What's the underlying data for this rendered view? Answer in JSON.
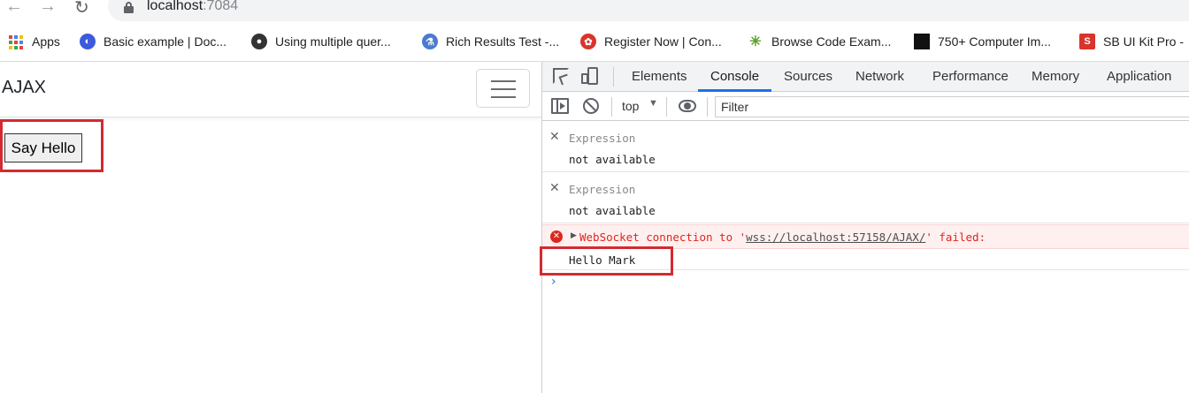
{
  "browser": {
    "url_host": "localhost",
    "url_port": ":7084",
    "bookmarks": [
      {
        "label": "Apps",
        "icon": "apps-grid-icon"
      },
      {
        "label": "Basic example | Doc...",
        "icon": "circle-blue-icon",
        "color": "#3b5bdb"
      },
      {
        "label": "Using multiple quer...",
        "icon": "ninja-icon",
        "color": "#333333"
      },
      {
        "label": "Rich Results Test -...",
        "icon": "tester-icon",
        "color": "#4a7bd0"
      },
      {
        "label": "Register Now | Con...",
        "icon": "red-badge-icon",
        "color": "#d9342b"
      },
      {
        "label": "Browse Code Exam...",
        "icon": "spark-icon",
        "color": "#5aa02c"
      },
      {
        "label": "750+ Computer Im...",
        "icon": "unsplash-icon",
        "color": "#111111"
      },
      {
        "label": "SB UI Kit Pro -",
        "icon": "s-logo-icon",
        "color": "#d9342b"
      }
    ]
  },
  "page": {
    "brand": "AJAX",
    "say_hello_label": "Say Hello"
  },
  "devtools": {
    "tabs": [
      "Elements",
      "Console",
      "Sources",
      "Network",
      "Performance",
      "Memory",
      "Application"
    ],
    "active_tab": "Console",
    "context": "top",
    "filter_placeholder": "Filter",
    "live_expressions": [
      {
        "label": "Expression",
        "value": "not available"
      },
      {
        "label": "Expression",
        "value": "not available"
      }
    ],
    "error": {
      "prefix": "WebSocket connection to '",
      "link": "wss://localhost:57158/AJAX/",
      "suffix": "' failed:"
    },
    "log": "Hello Mark",
    "prompt": "›"
  },
  "colors": {
    "highlight": "#d32a30",
    "error": "#e0251e",
    "accent": "#1a73e8"
  }
}
